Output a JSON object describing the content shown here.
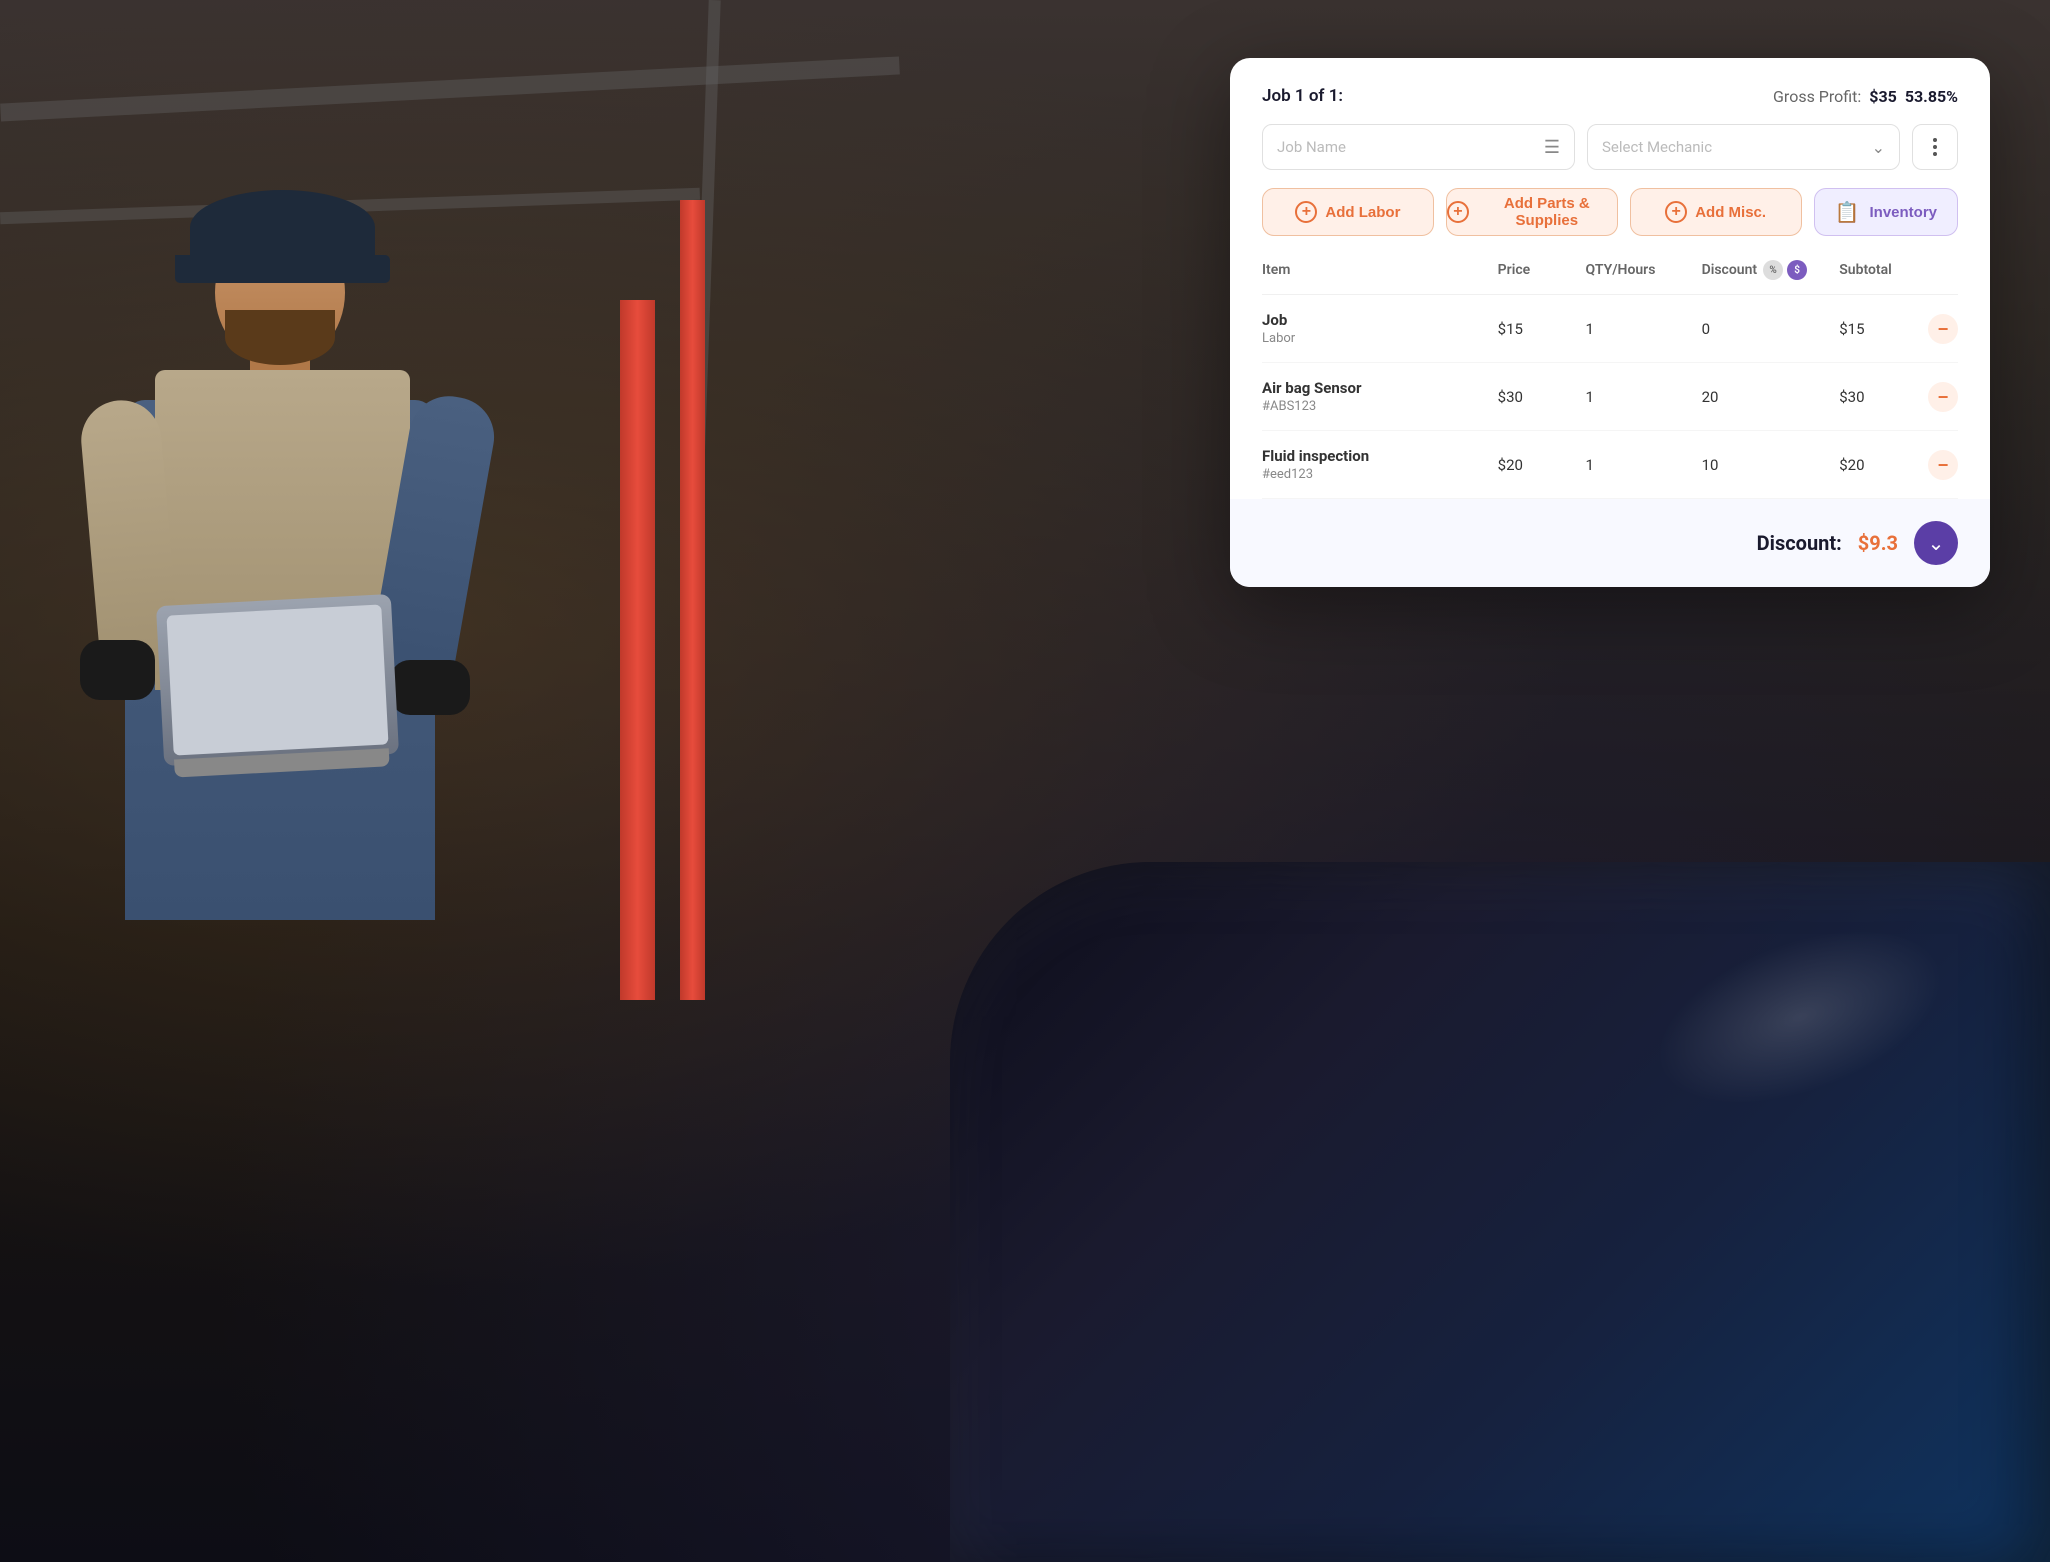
{
  "background": {
    "colors": [
      "#2a2a2a",
      "#1a1a1a"
    ]
  },
  "header": {
    "job_label": "Job 1 of 1:",
    "gross_profit_label": "Gross Profit:",
    "gross_profit_amount": "$35",
    "gross_profit_percent": "53.85%"
  },
  "job_name_input": {
    "placeholder": "Job Name"
  },
  "mechanic_select": {
    "placeholder": "Select Mechanic"
  },
  "actions": {
    "add_labor": "Add Labor",
    "add_parts": "Add Parts & Supplies",
    "add_misc": "Add Misc.",
    "inventory": "Inventory"
  },
  "table": {
    "columns": {
      "item": "Item",
      "price": "Price",
      "qty_hours": "QTY/Hours",
      "discount": "Discount",
      "subtotal": "Subtotal"
    },
    "rows": [
      {
        "name": "Job",
        "sub": "Labor",
        "price": "$15",
        "qty": "1",
        "discount": "0",
        "subtotal": "$15"
      },
      {
        "name": "Air bag Sensor",
        "sub": "#ABS123",
        "price": "$30",
        "qty": "1",
        "discount": "20",
        "subtotal": "$30"
      },
      {
        "name": "Fluid inspection",
        "sub": "#eed123",
        "price": "$20",
        "qty": "1",
        "discount": "10",
        "subtotal": "$20"
      }
    ]
  },
  "discount_footer": {
    "label": "Discount:",
    "amount": "$9.3"
  }
}
